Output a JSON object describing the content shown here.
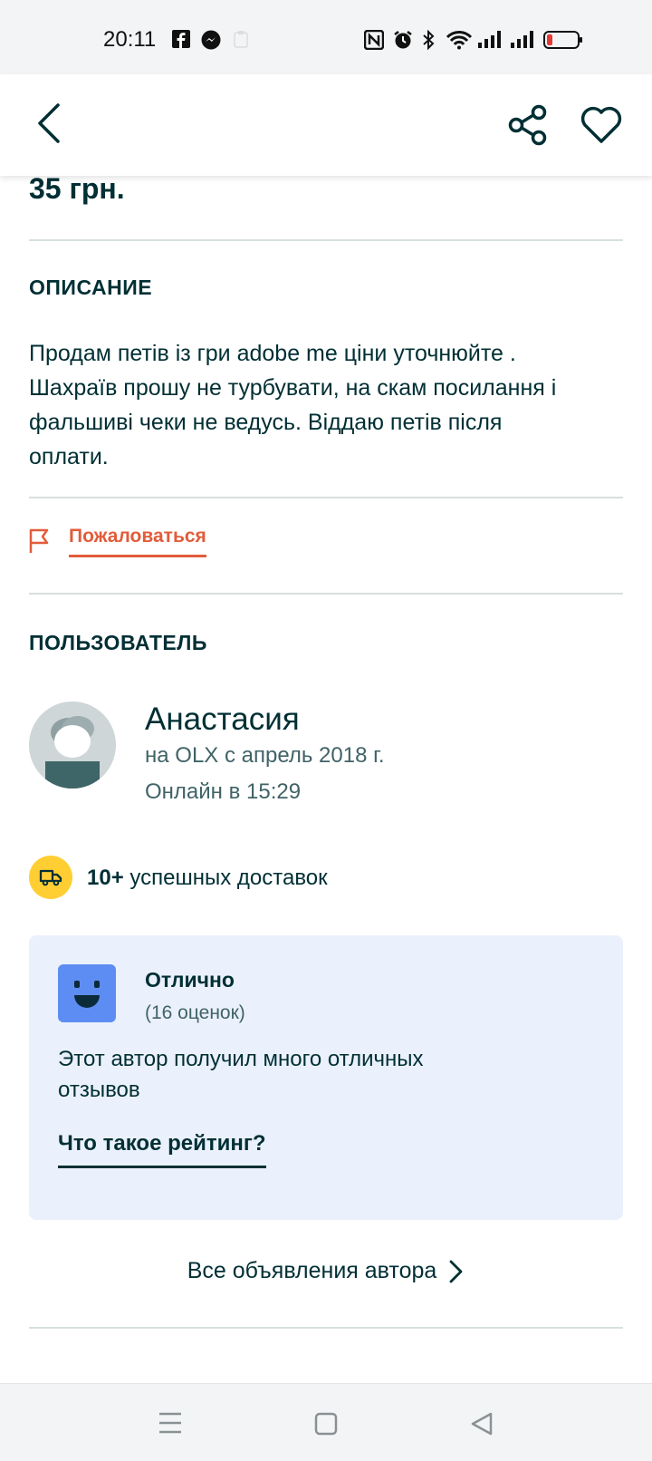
{
  "status_bar": {
    "time": "20:11",
    "left_icons": [
      "facebook-icon",
      "messenger-icon",
      "clipboard-icon"
    ],
    "right_icons": [
      "nfc-icon",
      "alarm-icon",
      "bluetooth-icon",
      "wifi-icon",
      "signal-icon",
      "signal-icon",
      "battery-low-icon"
    ],
    "battery_color": "#e53935"
  },
  "app_bar": {
    "back_icon": "chevron-left-icon",
    "share_icon": "share-icon",
    "favorite_icon": "heart-icon"
  },
  "listing": {
    "price": "35 грн.",
    "description_title": "ОПИСАНИЕ",
    "description_lines": [
      "Продам петів із гри adobe me ціни уточнюйте .",
      "Шахраїв прошу не турбувати, на скам посилання і",
      "фальшиві чеки не ведусь. Віддаю петів після",
      "оплати."
    ],
    "report_label": "Пожаловаться",
    "report_icon": "flag-icon"
  },
  "user": {
    "section_title": "ПОЛЬЗОВАТЕЛЬ",
    "name": "Анастасия",
    "member_since": "на OLX с апрель 2018 г.",
    "last_online": "Онлайн в 15:29"
  },
  "deliveries": {
    "count": "10+",
    "label": "успешных доставок",
    "icon": "truck-icon"
  },
  "rating": {
    "title": "Отлично",
    "count": "(16 оценок)",
    "text_lines": [
      "Этот автор получил много отличных",
      "отзывов"
    ],
    "link": "Что такое рейтинг?",
    "icon": "smiley-face-icon"
  },
  "author_ads": {
    "label": "Все объявления автора"
  },
  "nav_bar": {
    "icons": [
      "menu-icon",
      "home-square-icon",
      "back-triangle-icon"
    ]
  },
  "colors": {
    "primary_text": "#002f34",
    "accent_orange": "#e25c3a",
    "rating_card_bg": "#ebf1fc",
    "rating_face": "#5d8df2",
    "delivery_badge": "#ffce32"
  }
}
